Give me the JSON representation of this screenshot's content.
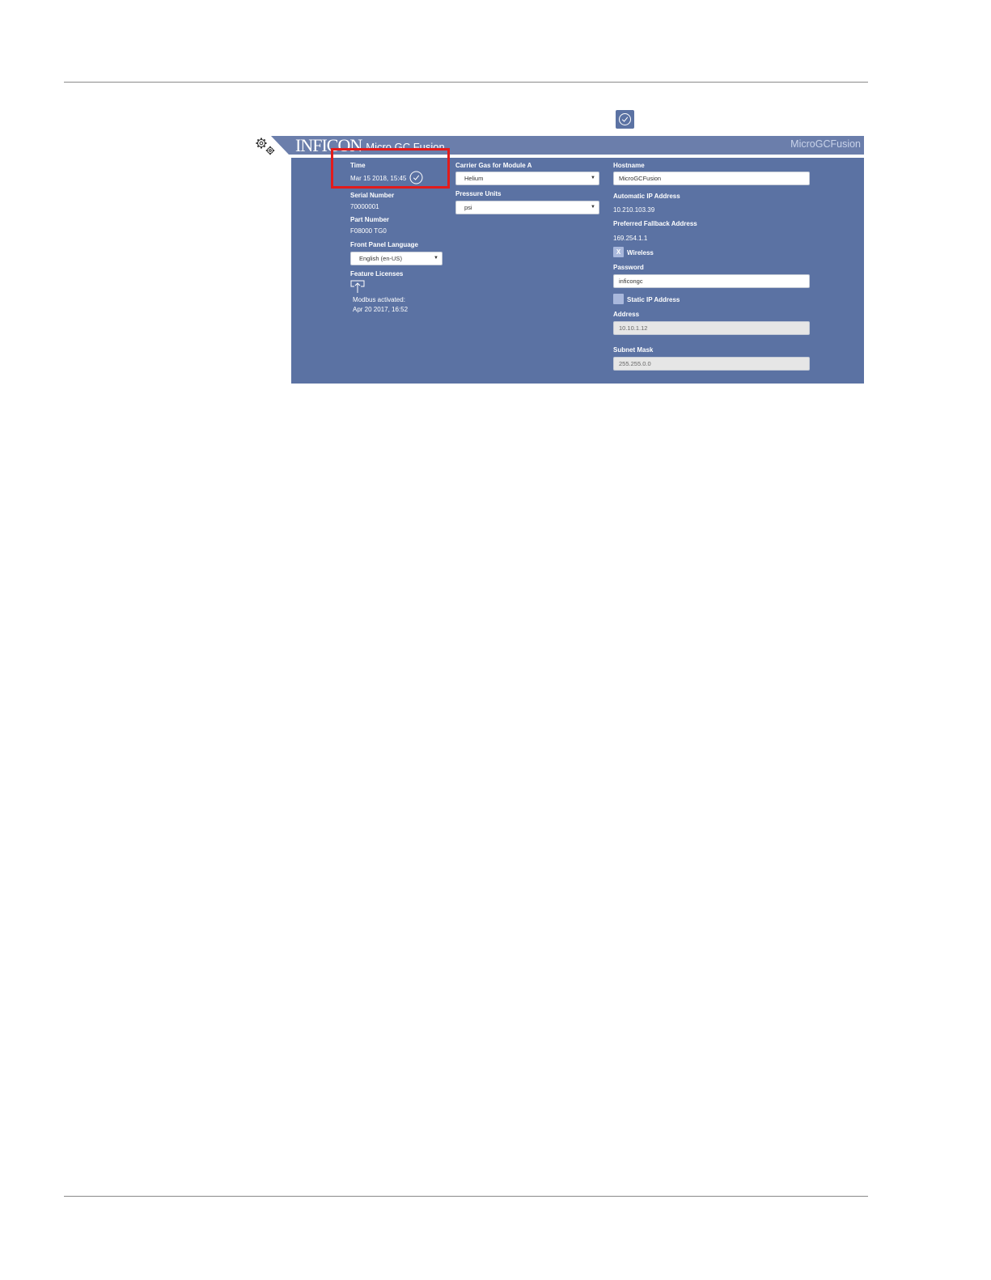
{
  "brand": {
    "logo_text": "INFICON",
    "product_name": "Micro GC Fusion",
    "hostname_header": "MicroGCFusion"
  },
  "icons": {
    "settings": "gear-icon",
    "time_sync": "clock-check-icon",
    "upload": "upload-icon"
  },
  "colors": {
    "panel": "#5b72a3",
    "header": "#6b7eab",
    "highlight": "#e21b1b"
  },
  "left": {
    "time_label": "Time",
    "time_value": "Mar 15 2018, 15:45",
    "serial_label": "Serial Number",
    "serial_value": "70000001",
    "part_label": "Part Number",
    "part_value": "F08000 TG0",
    "language_label": "Front Panel Language",
    "language_value": "English (en-US)",
    "licenses_label": "Feature Licenses",
    "modbus_line1": "Modbus activated:",
    "modbus_line2": "Apr 20 2017, 16:52"
  },
  "middle": {
    "carrier_label": "Carrier Gas for Module A",
    "carrier_value": "Helium",
    "pressure_label": "Pressure Units",
    "pressure_value": "psi"
  },
  "right": {
    "hostname_label": "Hostname",
    "hostname_value": "MicroGCFusion",
    "auto_ip_label": "Automatic IP Address",
    "auto_ip_value": "10.210.103.39",
    "fallback_label": "Preferred Fallback Address",
    "fallback_value": "169.254.1.1",
    "wireless_label": "Wireless",
    "wireless_mark": "X",
    "password_label": "Password",
    "password_value": "inficongc",
    "static_ip_label": "Static IP Address",
    "address_label": "Address",
    "address_value": "10.10.1.12",
    "subnet_label": "Subnet Mask",
    "subnet_value": "255.255.0.0"
  }
}
